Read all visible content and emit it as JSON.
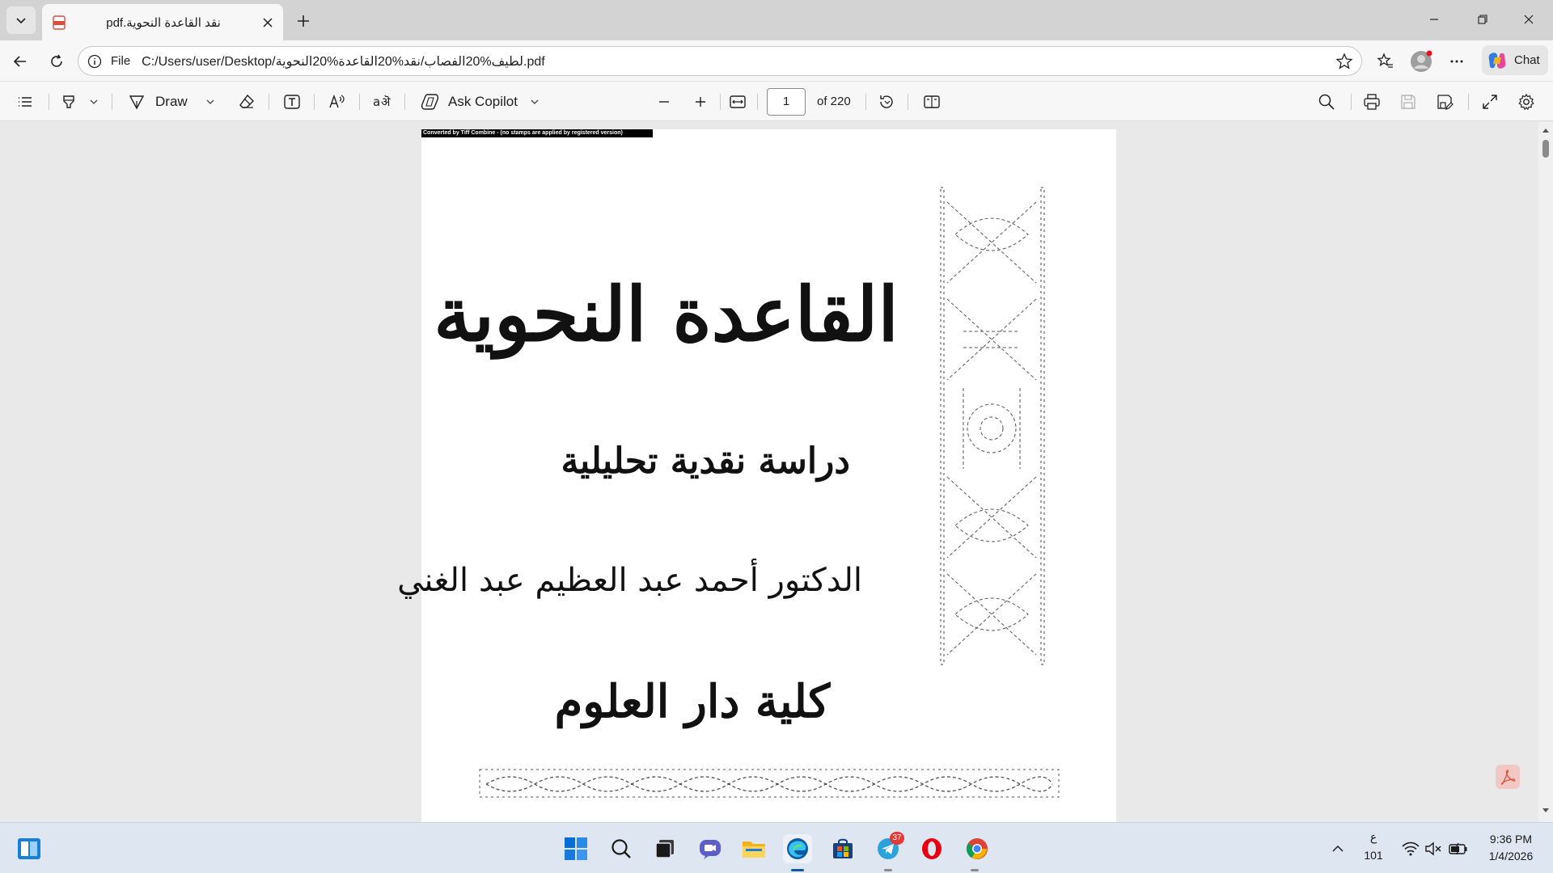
{
  "tab": {
    "title": "pdf.نقد القاعدة النحوية",
    "pdf_icon_label": "PDF"
  },
  "address": {
    "scheme_label": "File",
    "url": "C:/Users/user/Desktop/لطيف%20الفصاب/نقد%20القاعدة%20النحوية.pdf"
  },
  "toolbar": {
    "draw_label": "Draw",
    "ask_copilot_label": "Ask Copilot",
    "page_current": "1",
    "page_total": "of 220"
  },
  "chat_label": "Chat",
  "document": {
    "banner": "Converted by Tiff Combine - (no stamps are applied by registered version)",
    "title": "القاعدة النحوية",
    "subtitle": "دراسة نقدية تحليلية",
    "author": "الدكتور أحمد عبد العظيم عبد الغني",
    "college": "كلية دار العلوم"
  },
  "taskbar": {
    "telegram_badge": "37",
    "ime_char": "ع",
    "ime_code": "101",
    "time": "9:36 PM",
    "date": "1/4/2026"
  },
  "colors": {
    "edge_blue": "#0c59a4",
    "opera_red": "#e60012",
    "telegram_blue": "#2aa3dd",
    "acrobat_red": "#d94e3f"
  }
}
